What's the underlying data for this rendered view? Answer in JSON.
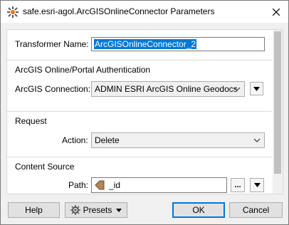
{
  "window": {
    "title": "safe.esri-agol.ArcGISOnlineConnector Parameters",
    "app_icon": "fme-transformer-icon",
    "close_icon": "close-icon"
  },
  "form": {
    "transformer_name": {
      "label": "Transformer Name:",
      "value": "ArcGISOnlineConnector_2"
    },
    "authentication": {
      "group_title": "ArcGIS Online/Portal Authentication",
      "connection_label": "ArcGIS Connection:",
      "connection_value": "ADMIN ESRI ArcGIS Online Geodocs"
    },
    "request": {
      "group_title": "Request",
      "action_label": "Action:",
      "action_value": "Delete"
    },
    "content_source": {
      "group_title": "Content Source",
      "path_label": "Path:",
      "path_value": "_id",
      "ellipsis_label": "..."
    }
  },
  "footer": {
    "help_label": "Help",
    "presets_label": "Presets",
    "ok_label": "OK",
    "cancel_label": "Cancel"
  }
}
